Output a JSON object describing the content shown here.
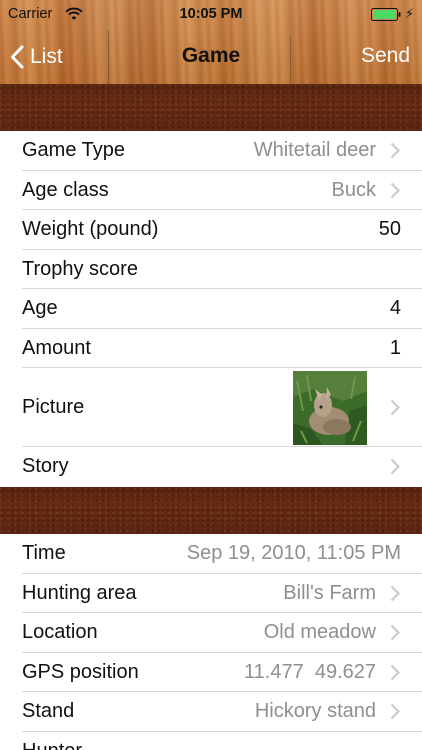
{
  "status_bar": {
    "carrier": "Carrier",
    "time": "10:05 PM"
  },
  "nav": {
    "back_label": "List",
    "title": "Game",
    "send_label": "Send"
  },
  "section1": {
    "rows": [
      {
        "label": "Game Type",
        "value": "Whitetail deer"
      },
      {
        "label": "Age class",
        "value": "Buck"
      },
      {
        "label": "Weight (pound)",
        "value": "50"
      },
      {
        "label": "Trophy score",
        "value": ""
      },
      {
        "label": "Age",
        "value": "4"
      },
      {
        "label": "Amount",
        "value": "1"
      },
      {
        "label": "Picture",
        "value": ""
      },
      {
        "label": "Story",
        "value": ""
      }
    ]
  },
  "section2": {
    "rows": [
      {
        "label": "Time",
        "value": "Sep 19, 2010, 11:05 PM"
      },
      {
        "label": "Hunting area",
        "value": "Bill's Farm"
      },
      {
        "label": "Location",
        "value": "Old meadow"
      },
      {
        "label": "GPS position",
        "value": "11.477  49.627"
      },
      {
        "label": "Stand",
        "value": "Hickory stand"
      },
      {
        "label": "Hunter",
        "value": ""
      }
    ]
  },
  "icons": {
    "wifi": "wifi-icon",
    "battery": "battery-icon",
    "back": "chevron-left-icon",
    "disclosure": "chevron-right-icon",
    "photo": "deer-photo"
  },
  "colors": {
    "battery_fill": "#4cd964",
    "secondary_text": "#8e8e93",
    "leather": "#5f2812"
  }
}
